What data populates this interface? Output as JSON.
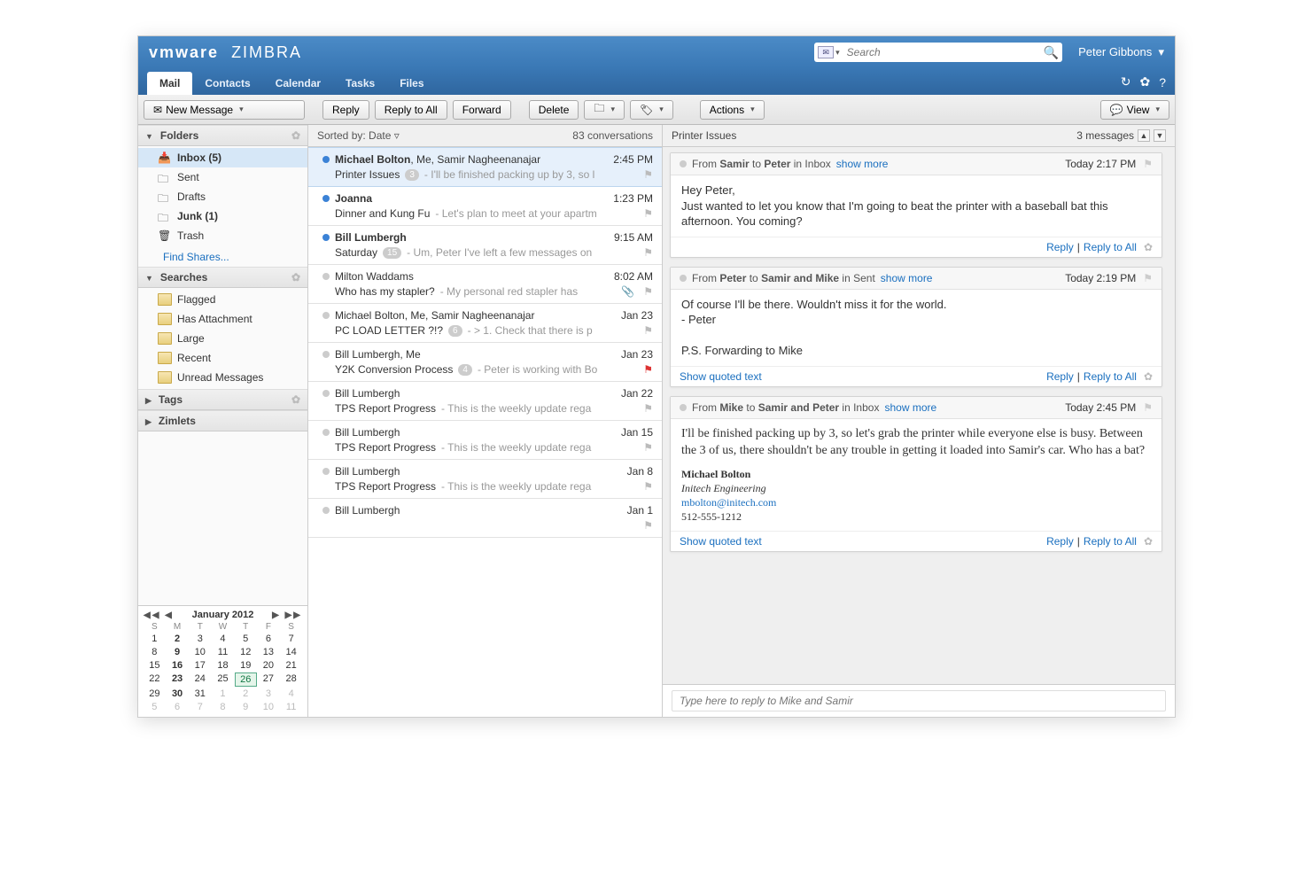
{
  "brand": {
    "vendor": "vmware",
    "product": "ZIMBRA"
  },
  "user": "Peter Gibbons",
  "search": {
    "placeholder": "Search"
  },
  "tabs": [
    "Mail",
    "Contacts",
    "Calendar",
    "Tasks",
    "Files"
  ],
  "toolbar": {
    "new_message": "New Message",
    "reply": "Reply",
    "reply_all": "Reply to All",
    "forward": "Forward",
    "delete": "Delete",
    "actions": "Actions",
    "view": "View"
  },
  "sidebar": {
    "folders_label": "Folders",
    "folders": [
      {
        "label": "Inbox (5)",
        "selected": true,
        "icon": "inbox"
      },
      {
        "label": "Sent",
        "icon": "folder"
      },
      {
        "label": "Drafts",
        "icon": "folder"
      },
      {
        "label": "Junk (1)",
        "icon": "folder",
        "bold": true
      },
      {
        "label": "Trash",
        "icon": "trash"
      }
    ],
    "find_shares": "Find Shares...",
    "searches_label": "Searches",
    "searches": [
      "Flagged",
      "Has Attachment",
      "Large",
      "Recent",
      "Unread Messages"
    ],
    "tags_label": "Tags",
    "zimlets_label": "Zimlets"
  },
  "calendar": {
    "title": "January 2012",
    "dow": [
      "S",
      "M",
      "T",
      "W",
      "T",
      "F",
      "S"
    ],
    "weeks": [
      [
        {
          "d": 1
        },
        {
          "d": 2,
          "b": 1
        },
        {
          "d": 3
        },
        {
          "d": 4
        },
        {
          "d": 5
        },
        {
          "d": 6
        },
        {
          "d": 7
        }
      ],
      [
        {
          "d": 8
        },
        {
          "d": 9,
          "b": 1
        },
        {
          "d": 10
        },
        {
          "d": 11
        },
        {
          "d": 12
        },
        {
          "d": 13
        },
        {
          "d": 14
        }
      ],
      [
        {
          "d": 15
        },
        {
          "d": 16,
          "b": 1
        },
        {
          "d": 17
        },
        {
          "d": 18
        },
        {
          "d": 19
        },
        {
          "d": 20
        },
        {
          "d": 21
        }
      ],
      [
        {
          "d": 22
        },
        {
          "d": 23,
          "b": 1
        },
        {
          "d": 24
        },
        {
          "d": 25
        },
        {
          "d": 26,
          "t": 1
        },
        {
          "d": 27
        },
        {
          "d": 28
        }
      ],
      [
        {
          "d": 29
        },
        {
          "d": 30,
          "b": 1
        },
        {
          "d": 31
        },
        {
          "d": 1,
          "o": 1
        },
        {
          "d": 2,
          "o": 1
        },
        {
          "d": 3,
          "o": 1
        },
        {
          "d": 4,
          "o": 1
        }
      ],
      [
        {
          "d": 5,
          "o": 1
        },
        {
          "d": 6,
          "o": 1
        },
        {
          "d": 7,
          "o": 1
        },
        {
          "d": 8,
          "o": 1
        },
        {
          "d": 9,
          "o": 1
        },
        {
          "d": 10,
          "o": 1
        },
        {
          "d": 11,
          "o": 1
        }
      ]
    ]
  },
  "msglist": {
    "sorted_by": "Sorted by: Date",
    "count": "83 conversations",
    "items": [
      {
        "from_html": "<b>Michael Bolton</b>, Me, Samir Nagheenanajar",
        "time": "2:45 PM",
        "subject": "Printer Issues",
        "badge": "3",
        "preview": "- I'll be finished packing up by 3, so l",
        "unread": true,
        "selected": true
      },
      {
        "from_html": "<b>Joanna</b>",
        "time": "1:23 PM",
        "subject": "Dinner and Kung Fu",
        "preview": "- Let's plan to meet at your apartm",
        "unread": true
      },
      {
        "from_html": "<b>Bill Lumbergh</b>",
        "time": "9:15 AM",
        "subject": "Saturday",
        "badge": "15",
        "preview": "- Um, Peter I've left a few messages on",
        "unread": true
      },
      {
        "from_html": "Milton Waddams",
        "time": "8:02 AM",
        "subject": "Who has my stapler?",
        "preview": "- My personal red stapler has",
        "attach": true
      },
      {
        "from_html": "Michael Bolton, Me, Samir Nagheenanajar",
        "time": "Jan 23",
        "subject": "PC LOAD LETTER ?!?",
        "badge": "6",
        "preview": "- > 1. Check that there is p"
      },
      {
        "from_html": "Bill Lumbergh, Me",
        "time": "Jan 23",
        "subject": "Y2K Conversion Process",
        "badge": "4",
        "preview": "- Peter is working with Bo",
        "flag": "red"
      },
      {
        "from_html": "Bill Lumbergh",
        "time": "Jan 22",
        "subject": "TPS Report Progress",
        "preview": "- This is the weekly update rega"
      },
      {
        "from_html": "Bill Lumbergh",
        "time": "Jan 15",
        "subject": "TPS Report Progress",
        "preview": "- This is the weekly update rega"
      },
      {
        "from_html": "Bill Lumbergh",
        "time": "Jan 8",
        "subject": "TPS Report Progress",
        "preview": "- This is the weekly update rega"
      },
      {
        "from_html": "Bill Lumbergh",
        "time": "Jan 1",
        "subject": "",
        "preview": ""
      }
    ]
  },
  "reader": {
    "title": "Printer Issues",
    "count": "3 messages",
    "messages": [
      {
        "head_html": "From <b>Samir</b> to <b>Peter</b> in Inbox",
        "show_more": "show more",
        "time": "Today 2:17 PM",
        "body": "Hey Peter,\nJust wanted to let you know that I'm going to beat the printer with a baseball bat this afternoon.  You coming?",
        "actions": [
          "Reply",
          "Reply to All"
        ]
      },
      {
        "head_html": "From <b>Peter</b> to <b>Samir and Mike</b> in Sent",
        "show_more": "show more",
        "time": "Today 2:19 PM",
        "body": "Of course I'll be there.  Wouldn't miss it for the world.\n- Peter\n\nP.S. Forwarding to Mike",
        "quoted": "Show quoted text",
        "actions": [
          "Reply",
          "Reply to All"
        ]
      },
      {
        "head_html": "From <b>Mike</b> to <b>Samir and Peter</b> in Inbox",
        "show_more": "show more",
        "time": "Today 2:45 PM",
        "serif": true,
        "body": "I'll be finished packing up by 3, so let's grab the printer while everyone else is busy.  Between the 3 of us, there shouldn't be any trouble in getting it loaded into Samir's car.  Who has a bat?",
        "sig": {
          "name": "Michael Bolton",
          "co": "Initech Engineering",
          "email": "mbolton@initech.com",
          "phone": "512-555-1212"
        },
        "quoted": "Show quoted text",
        "actions": [
          "Reply",
          "Reply to All"
        ]
      }
    ],
    "reply_placeholder": "Type here to reply to Mike and Samir"
  }
}
